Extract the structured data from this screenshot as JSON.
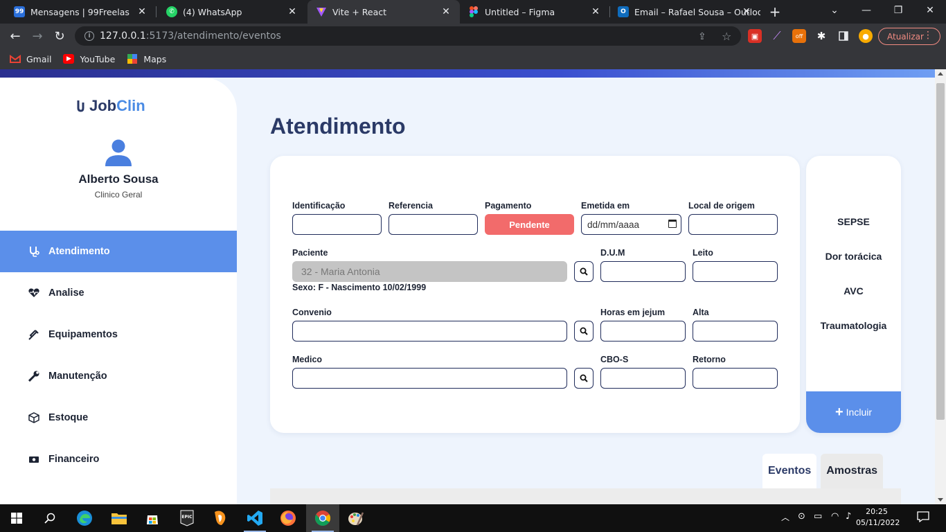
{
  "browser": {
    "tabs": [
      {
        "label": "Mensagens | 99Freelas",
        "icon": "99freelas-icon",
        "color": "#2a6fdb"
      },
      {
        "label": "(4) WhatsApp",
        "icon": "whatsapp-icon",
        "color": "#25d366"
      },
      {
        "label": "Vite + React",
        "icon": "vite-icon",
        "color": "#a259ff"
      },
      {
        "label": "Untitled – Figma",
        "icon": "figma-icon",
        "color": "#f24e1e"
      },
      {
        "label": "Email – Rafael Sousa – Outlook",
        "icon": "outlook-icon",
        "color": "#0f6cbd"
      }
    ],
    "url_host": "127.0.0.1",
    "url_path": ":5173/atendimento/eventos",
    "update_label": "Atualizar",
    "bookmarks": [
      {
        "label": "Gmail",
        "icon": "gmail-icon"
      },
      {
        "label": "YouTube",
        "icon": "youtube-icon"
      },
      {
        "label": "Maps",
        "icon": "maps-icon"
      }
    ]
  },
  "sidebar": {
    "logo_job": "Job",
    "logo_clin": "Clin",
    "user_name": "Alberto Sousa",
    "user_role": "Clinico Geral",
    "items": [
      {
        "label": "Atendimento",
        "icon": "stethoscope-icon",
        "active": true
      },
      {
        "label": "Analise",
        "icon": "heartbeat-icon",
        "active": false
      },
      {
        "label": "Equipamentos",
        "icon": "syringe-icon",
        "active": false
      },
      {
        "label": "Manutenção",
        "icon": "wrench-icon",
        "active": false
      },
      {
        "label": "Estoque",
        "icon": "box-icon",
        "active": false
      },
      {
        "label": "Financeiro",
        "icon": "money-icon",
        "active": false
      }
    ]
  },
  "main": {
    "title": "Atendimento",
    "form": {
      "identificacao_label": "Identificação",
      "referencia_label": "Referencia",
      "pagamento_label": "Pagamento",
      "pagamento_status": "Pendente",
      "emetida_label": "Emetida em",
      "emetida_placeholder": "dd/mm/aaaa",
      "local_label": "Local de origem",
      "paciente_label": "Paciente",
      "paciente_value": "32 - Maria Antonia",
      "paciente_info": "Sexo: F - Nascimento 10/02/1999",
      "dum_label": "D.U.M",
      "leito_label": "Leito",
      "convenio_label": "Convenio",
      "horas_label": "Horas em jejum",
      "alta_label": "Alta",
      "medico_label": "Medico",
      "cbo_label": "CBO-S",
      "retorno_label": "Retorno"
    },
    "events": [
      "SEPSE",
      "Dor torácica",
      "AVC",
      "Traumatologia"
    ],
    "include_label": "Incluir",
    "tabs": [
      {
        "label": "Eventos",
        "active": true
      },
      {
        "label": "Amostras",
        "active": false
      }
    ]
  },
  "taskbar": {
    "apps": [
      "start-icon",
      "search-icon",
      "edge-icon",
      "file-explorer-icon",
      "store-icon",
      "epic-games-icon",
      "fl-studio-icon",
      "vscode-icon",
      "firefox-icon",
      "chrome-icon",
      "paint-icon"
    ],
    "time": "20:25",
    "date": "05/11/2022"
  },
  "colors": {
    "accent": "#5b8fea",
    "title": "#2b3a67",
    "pending": "#f26b6b",
    "page_bg": "#eef4fd"
  }
}
